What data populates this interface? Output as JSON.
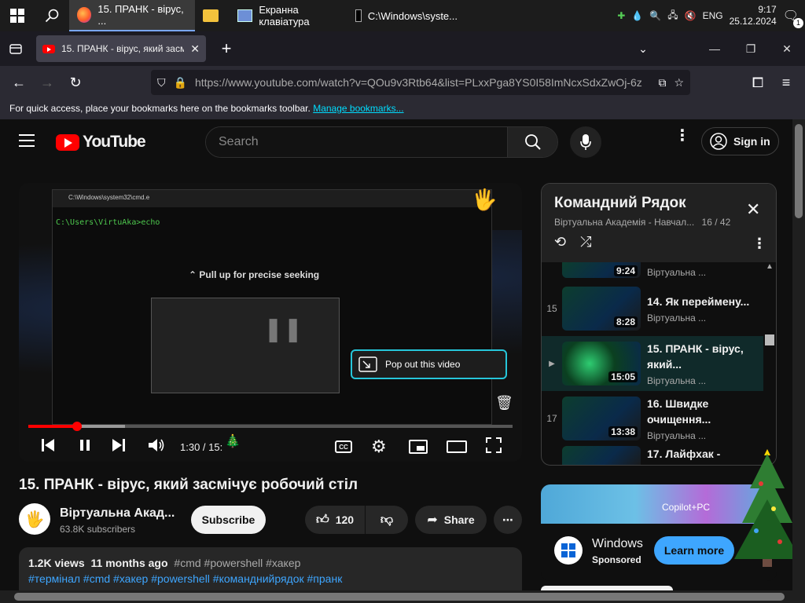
{
  "taskbar": {
    "tasks": [
      {
        "label": "15. ПРАНК - вірус, ...",
        "icon": "firefox-icon"
      },
      {
        "label": "",
        "icon": "file-explorer-icon"
      },
      {
        "label": "Екранна клавіатура",
        "icon": "onscreen-keyboard-icon"
      },
      {
        "label": "C:\\Windows\\syste...",
        "icon": "cmd-icon"
      }
    ],
    "lang": "ENG",
    "time": "9:17",
    "date": "25.12.2024",
    "notification_count": "1"
  },
  "browser": {
    "tab_title": "15. ПРАНК - вірус, який засм",
    "url": "https://www.youtube.com/watch?v=QOu9v3Rtb64&list=PLxxPga8YS0I58ImNcxSdxZwOj-6z",
    "bookmarks_text": "For quick access, place your bookmarks here on the bookmarks toolbar.",
    "bookmarks_link": "Manage bookmarks...",
    "accent": "#00ddff"
  },
  "youtube": {
    "logo_text": "YouTube",
    "country": "",
    "search_placeholder": "Search",
    "sign_in": "Sign in",
    "brand_color": "#ff0000"
  },
  "player": {
    "cmd_title": "C:\\Windows\\system32\\cmd.e",
    "cmd_prompt": "C:\\Users\\VirtuAka>echo",
    "seek_hint": "Pull up for precise seeking",
    "popout_label": "Pop out this video",
    "time": "1:30 / 15:",
    "progress": 0.1,
    "buffered": 0.2
  },
  "video": {
    "title": "15. ПРАНК - вірус, який засмічує робочий стіл",
    "channel": "Віртуальна Акад...",
    "subscribers": "63.8K subscribers",
    "subscribe": "Subscribe",
    "likes": "120",
    "share": "Share",
    "views": "1.2K views",
    "age": "11 months ago",
    "tags_line1_plain": "#cmd #powershell #хакер",
    "tags_line2": "#термінал #cmd #хакер #powershell  #команднийрядок #пранк"
  },
  "playlist": {
    "title": "Командний Рядок",
    "subtitle": "Віртуальна Академія - Навчал...",
    "position": "16 / 42",
    "items": [
      {
        "num": "",
        "duration": "9:24",
        "title": "",
        "channel": "Віртуальна ..."
      },
      {
        "num": "15",
        "duration": "8:28",
        "title": "14. Як переймену...",
        "channel": "Віртуальна ..."
      },
      {
        "num": "▶",
        "duration": "15:05",
        "title": "15. ПРАНК - вірус, який...",
        "channel": "Віртуальна ..."
      },
      {
        "num": "17",
        "duration": "13:38",
        "title": "16. Швидке очищення...",
        "channel": "Віртуальна ..."
      },
      {
        "num": "",
        "duration": "",
        "title": "17. Лайфхак -",
        "channel": ""
      }
    ]
  },
  "ad": {
    "banner": "Copilot+PC",
    "brand": "Windows",
    "sponsored": "Sponsored",
    "cta": "Learn more"
  }
}
